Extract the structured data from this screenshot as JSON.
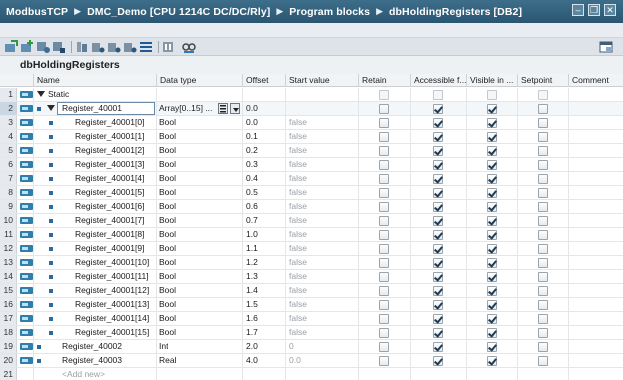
{
  "breadcrumb": [
    "ModbusTCP",
    "DMC_Demo [CPU 1214C DC/DC/Rly]",
    "Program blocks",
    "dbHoldingRegisters [DB2]"
  ],
  "window_controls": {
    "minimize": "‒",
    "restore": "❐",
    "close": "✕"
  },
  "block_title": "dbHoldingRegisters",
  "columns": [
    "Name",
    "Data type",
    "Offset",
    "Start value",
    "Retain",
    "Accessible f...",
    "Visible in ...",
    "Setpoint",
    "Comment"
  ],
  "rows": [
    {
      "num": "1",
      "name": "Static",
      "type": "",
      "offset": "",
      "start": "",
      "level": 0,
      "kind": "static",
      "cbs": false
    },
    {
      "num": "2",
      "name": "Register_40001",
      "type": "Array[0..15] ...",
      "offset": "0.0",
      "start": "",
      "level": 1,
      "kind": "array",
      "cbs": true,
      "retain": false,
      "access": true,
      "visible": true,
      "setpoint": false
    },
    {
      "num": "3",
      "name": "Register_40001[0]",
      "type": "Bool",
      "offset": "0.0",
      "start": "false",
      "level": 2,
      "kind": "elem",
      "cbs": true,
      "retain": false,
      "access": true,
      "visible": true,
      "setpoint": false
    },
    {
      "num": "4",
      "name": "Register_40001[1]",
      "type": "Bool",
      "offset": "0.1",
      "start": "false",
      "level": 2,
      "kind": "elem",
      "cbs": true,
      "retain": false,
      "access": true,
      "visible": true,
      "setpoint": false
    },
    {
      "num": "5",
      "name": "Register_40001[2]",
      "type": "Bool",
      "offset": "0.2",
      "start": "false",
      "level": 2,
      "kind": "elem",
      "cbs": true,
      "retain": false,
      "access": true,
      "visible": true,
      "setpoint": false
    },
    {
      "num": "6",
      "name": "Register_40001[3]",
      "type": "Bool",
      "offset": "0.3",
      "start": "false",
      "level": 2,
      "kind": "elem",
      "cbs": true,
      "retain": false,
      "access": true,
      "visible": true,
      "setpoint": false
    },
    {
      "num": "7",
      "name": "Register_40001[4]",
      "type": "Bool",
      "offset": "0.4",
      "start": "false",
      "level": 2,
      "kind": "elem",
      "cbs": true,
      "retain": false,
      "access": true,
      "visible": true,
      "setpoint": false
    },
    {
      "num": "8",
      "name": "Register_40001[5]",
      "type": "Bool",
      "offset": "0.5",
      "start": "false",
      "level": 2,
      "kind": "elem",
      "cbs": true,
      "retain": false,
      "access": true,
      "visible": true,
      "setpoint": false
    },
    {
      "num": "9",
      "name": "Register_40001[6]",
      "type": "Bool",
      "offset": "0.6",
      "start": "false",
      "level": 2,
      "kind": "elem",
      "cbs": true,
      "retain": false,
      "access": true,
      "visible": true,
      "setpoint": false
    },
    {
      "num": "10",
      "name": "Register_40001[7]",
      "type": "Bool",
      "offset": "0.7",
      "start": "false",
      "level": 2,
      "kind": "elem",
      "cbs": true,
      "retain": false,
      "access": true,
      "visible": true,
      "setpoint": false
    },
    {
      "num": "11",
      "name": "Register_40001[8]",
      "type": "Bool",
      "offset": "1.0",
      "start": "false",
      "level": 2,
      "kind": "elem",
      "cbs": true,
      "retain": false,
      "access": true,
      "visible": true,
      "setpoint": false
    },
    {
      "num": "12",
      "name": "Register_40001[9]",
      "type": "Bool",
      "offset": "1.1",
      "start": "false",
      "level": 2,
      "kind": "elem",
      "cbs": true,
      "retain": false,
      "access": true,
      "visible": true,
      "setpoint": false
    },
    {
      "num": "13",
      "name": "Register_40001[10]",
      "type": "Bool",
      "offset": "1.2",
      "start": "false",
      "level": 2,
      "kind": "elem",
      "cbs": true,
      "retain": false,
      "access": true,
      "visible": true,
      "setpoint": false
    },
    {
      "num": "14",
      "name": "Register_40001[11]",
      "type": "Bool",
      "offset": "1.3",
      "start": "false",
      "level": 2,
      "kind": "elem",
      "cbs": true,
      "retain": false,
      "access": true,
      "visible": true,
      "setpoint": false
    },
    {
      "num": "15",
      "name": "Register_40001[12]",
      "type": "Bool",
      "offset": "1.4",
      "start": "false",
      "level": 2,
      "kind": "elem",
      "cbs": true,
      "retain": false,
      "access": true,
      "visible": true,
      "setpoint": false
    },
    {
      "num": "16",
      "name": "Register_40001[13]",
      "type": "Bool",
      "offset": "1.5",
      "start": "false",
      "level": 2,
      "kind": "elem",
      "cbs": true,
      "retain": false,
      "access": true,
      "visible": true,
      "setpoint": false
    },
    {
      "num": "17",
      "name": "Register_40001[14]",
      "type": "Bool",
      "offset": "1.6",
      "start": "false",
      "level": 2,
      "kind": "elem",
      "cbs": true,
      "retain": false,
      "access": true,
      "visible": true,
      "setpoint": false
    },
    {
      "num": "18",
      "name": "Register_40001[15]",
      "type": "Bool",
      "offset": "1.7",
      "start": "false",
      "level": 2,
      "kind": "elem",
      "cbs": true,
      "retain": false,
      "access": true,
      "visible": true,
      "setpoint": false
    },
    {
      "num": "19",
      "name": "Register_40002",
      "type": "Int",
      "offset": "2.0",
      "start": "0",
      "level": 1,
      "kind": "var",
      "cbs": true,
      "retain": false,
      "access": true,
      "visible": true,
      "setpoint": false
    },
    {
      "num": "20",
      "name": "Register_40003",
      "type": "Real",
      "offset": "4.0",
      "start": "0.0",
      "level": 1,
      "kind": "var",
      "cbs": true,
      "retain": false,
      "access": true,
      "visible": true,
      "setpoint": false
    },
    {
      "num": "21",
      "name": "<Add new>",
      "type": "",
      "offset": "",
      "start": "",
      "level": 1,
      "kind": "addnew",
      "cbs": false
    }
  ],
  "colors": {
    "titlebar": "#2f6080",
    "row_icon": "#2f7fae",
    "selected_row": "#c9d7e3"
  }
}
